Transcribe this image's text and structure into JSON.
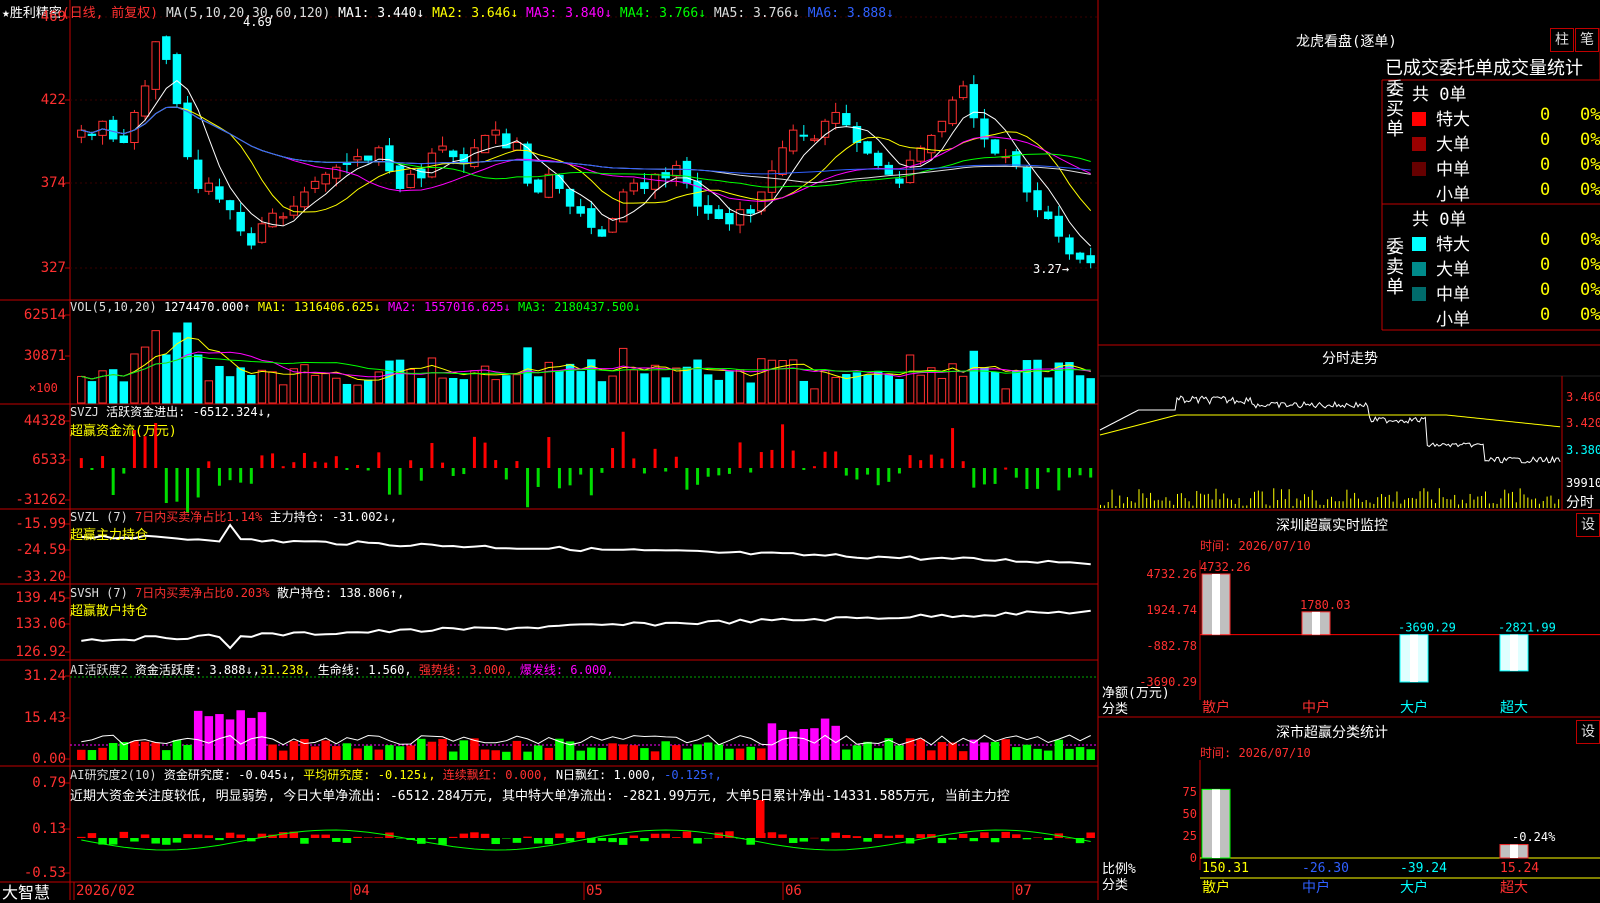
{
  "app": {
    "logo": "大智慧"
  },
  "main": {
    "title": "★胜利精密",
    "period": "(日线, 前复权)",
    "ma": [
      {
        "label": "MA(5,10,20,30,60,120)",
        "color": "#dddddd"
      },
      {
        "label": "MA1: 3.440↓",
        "color": "#ffffff"
      },
      {
        "label": "MA2: 3.646↓",
        "color": "#ffff00"
      },
      {
        "label": "MA3: 3.840↓",
        "color": "#ff00ff"
      },
      {
        "label": "MA4: 3.766↓",
        "color": "#00ff00"
      },
      {
        "label": "MA5: 3.766↓",
        "color": "#dddddd"
      },
      {
        "label": "MA6: 3.888↓",
        "color": "#3060ff"
      }
    ],
    "y_ticks": [
      "469",
      "422",
      "374",
      "327"
    ],
    "high_label": "4.69",
    "low_label": "3.27→"
  },
  "vol": {
    "title": "VOL(5,10,20)",
    "value": "1274470.000↑",
    "ma1": "MA1: 1316406.625↓",
    "ma2": "MA2: 1557016.625↓",
    "ma3": "MA3: 2180437.500↓",
    "y_ticks": [
      "62514",
      "30871"
    ],
    "unit": "×100"
  },
  "svzj": {
    "title": "SVZJ",
    "label": "活跃资金进出: -6512.324↓,",
    "subtitle": "超赢资金流(万元)",
    "y_ticks": [
      "44328",
      "6533",
      "-31262"
    ]
  },
  "svzl": {
    "title": "SVZL (7)",
    "ratio": "7日内买卖净占比1.14%",
    "hold": "主力持仓: -31.002↓,",
    "subtitle": "超赢主力持仓",
    "y_ticks": [
      "-15.99",
      "-24.59",
      "-33.20"
    ]
  },
  "svsh": {
    "title": "SVSH (7)",
    "ratio": "7日内买卖净占比0.203%",
    "hold": "散户持仓: 138.806↑,",
    "subtitle": "超赢散户持仓",
    "y_ticks": [
      "139.45",
      "133.06",
      "126.92"
    ]
  },
  "ai2": {
    "title": "AI活跃度2",
    "a": "资金活跃度: 3.888↓,",
    "b": "31.238,",
    "c": "生命线: 1.560,",
    "d": "强势线: 3.000,",
    "e": "爆发线: 6.000,",
    "y_ticks": [
      "31.24",
      "15.43",
      "0.00"
    ]
  },
  "ai_study": {
    "title": "AI研究度2(10)",
    "a": "资金研究度: -0.045↓,",
    "b": "平均研究度: -0.125↓,",
    "c": "连续飘红: 0.000,",
    "d": "N日飘红: 1.000,",
    "e": "-0.125↑,",
    "note": "近期大资金关注度较低, 明显弱势, 今日大单净流出: -6512.284万元, 其中特大单净流出: -2821.99万元, 大单5日累计净出-14331.585万元, 当前主力控",
    "y_ticks": [
      "0.79",
      "0.13",
      "-0.53"
    ]
  },
  "xaxis": {
    "labels": [
      "2026/02",
      "04",
      "05",
      "06",
      "07"
    ]
  },
  "longhu": {
    "title": "龙虎看盘(逐单)",
    "btn1": "柱",
    "btn2": "笔",
    "stat_title": "已成交委托单成交量统计",
    "buy": {
      "side": "委买单",
      "total": "共 0单",
      "rows": [
        {
          "name": "特大",
          "color": "#ff0000",
          "v": "0",
          "p": "0%"
        },
        {
          "name": "大单",
          "color": "#990000",
          "v": "0",
          "p": "0%"
        },
        {
          "name": "中单",
          "color": "#660000",
          "v": "0",
          "p": "0%"
        },
        {
          "name": "小单",
          "color": "#000000",
          "v": "0",
          "p": "0%"
        }
      ]
    },
    "sell": {
      "side": "委卖单",
      "total": "共 0单",
      "rows": [
        {
          "name": "特大",
          "color": "#00ffff",
          "v": "0",
          "p": "0%"
        },
        {
          "name": "大单",
          "color": "#008b8b",
          "v": "0",
          "p": "0%"
        },
        {
          "name": "中单",
          "color": "#006b6b",
          "v": "0",
          "p": "0%"
        },
        {
          "name": "小单",
          "color": "#000000",
          "v": "0",
          "p": "0%"
        }
      ]
    }
  },
  "intraday": {
    "title": "分时走势",
    "prices": [
      "3.460",
      "3.420",
      "3.380"
    ],
    "vol": "39910",
    "unit": "分时"
  },
  "monitor": {
    "title": "深圳超赢实时监控",
    "btn": "设",
    "time": "时间: 2026/07/10",
    "y_ticks": [
      "4732.26",
      "1924.74",
      "-882.78",
      "-3690.29"
    ],
    "net_label": "净额(万元)",
    "cat_label": "分类",
    "chart_data": {
      "type": "bar",
      "categories": [
        "散户",
        "中户",
        "大户",
        "超大"
      ],
      "values": [
        4732.26,
        1780.03,
        -3690.29,
        -2821.99
      ],
      "value_labels": [
        "4732.26",
        "1780.03",
        "-3690.29",
        "-2821.99"
      ]
    }
  },
  "classify": {
    "title": "深市超赢分类统计",
    "btn": "设",
    "time": "时间: 2026/07/10",
    "y_ticks": [
      "75",
      "50",
      "25",
      "0"
    ],
    "ratio_label": "比例%",
    "cat_label": "分类",
    "pct_label": "-0.24%",
    "chart_data": {
      "type": "bar",
      "categories": [
        "散户",
        "中户",
        "大户",
        "超大"
      ],
      "values": [
        150.31,
        -26.3,
        -39.24,
        15.24
      ],
      "value_labels": [
        "150.31",
        "-26.30",
        "-39.24",
        "15.24"
      ]
    }
  }
}
